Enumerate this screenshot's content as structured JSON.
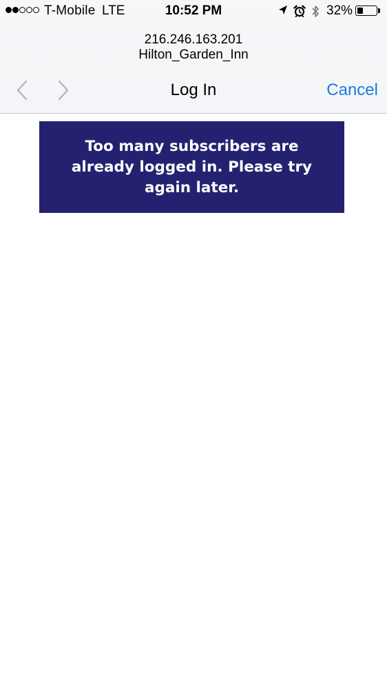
{
  "status_bar": {
    "signal_bars": [
      true,
      true,
      false,
      false,
      false
    ],
    "carrier": "T-Mobile",
    "network": "LTE",
    "time": "10:52 PM",
    "icons": [
      "location-arrow-icon",
      "alarm-icon",
      "bluetooth-icon"
    ],
    "battery_percent_label": "32%",
    "battery_level": 0.32
  },
  "browser": {
    "address_line_1": "216.246.163.201",
    "address_line_2": "Hilton_Garden_Inn",
    "back_icon": "chevron-left-icon",
    "forward_icon": "chevron-right-icon",
    "title": "Log In",
    "cancel_label": "Cancel"
  },
  "page": {
    "message": "Too many subscribers are already logged in. Please try again later."
  },
  "colors": {
    "accent": "#1a7ce0",
    "banner_bg": "#242270",
    "banner_text": "#ffffff",
    "nav_disabled": "#b8b8bc"
  }
}
